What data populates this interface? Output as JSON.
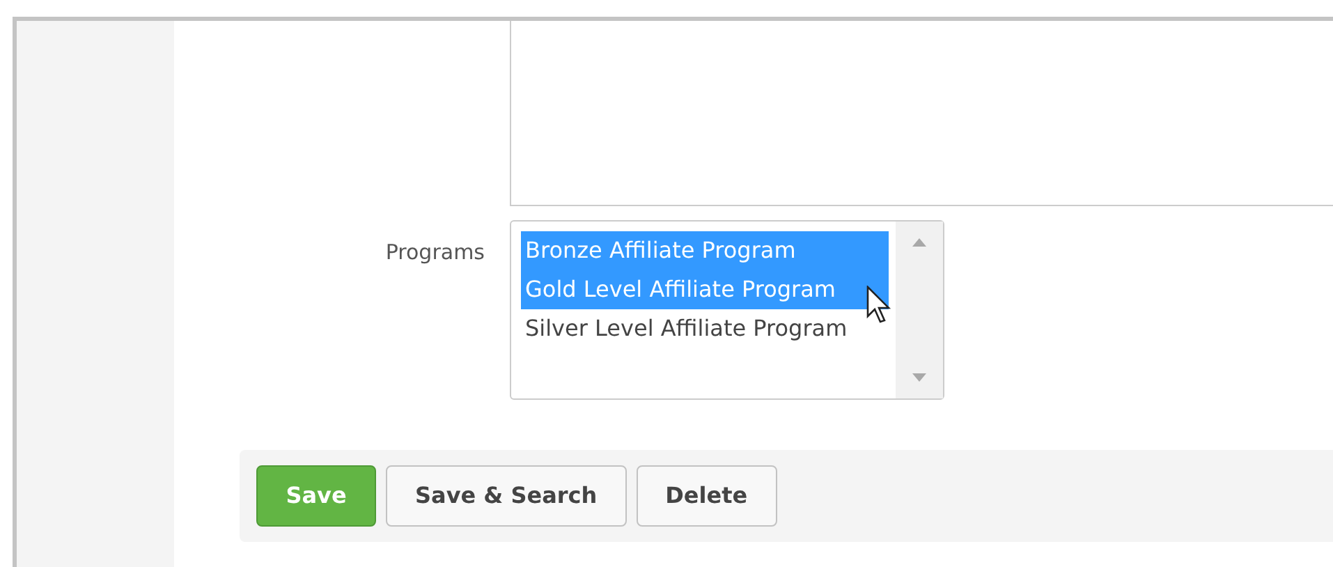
{
  "form": {
    "programs_label": "Programs",
    "programs": [
      {
        "label": "Bronze Affiliate Program",
        "selected": true
      },
      {
        "label": "Gold Level Affiliate Program",
        "selected": true
      },
      {
        "label": "Silver Level Affiliate Program",
        "selected": false
      }
    ]
  },
  "buttons": [
    {
      "label": "Save",
      "kind": "primary"
    },
    {
      "label": "Save & Search",
      "kind": "default"
    },
    {
      "label": "Delete",
      "kind": "default"
    }
  ]
}
